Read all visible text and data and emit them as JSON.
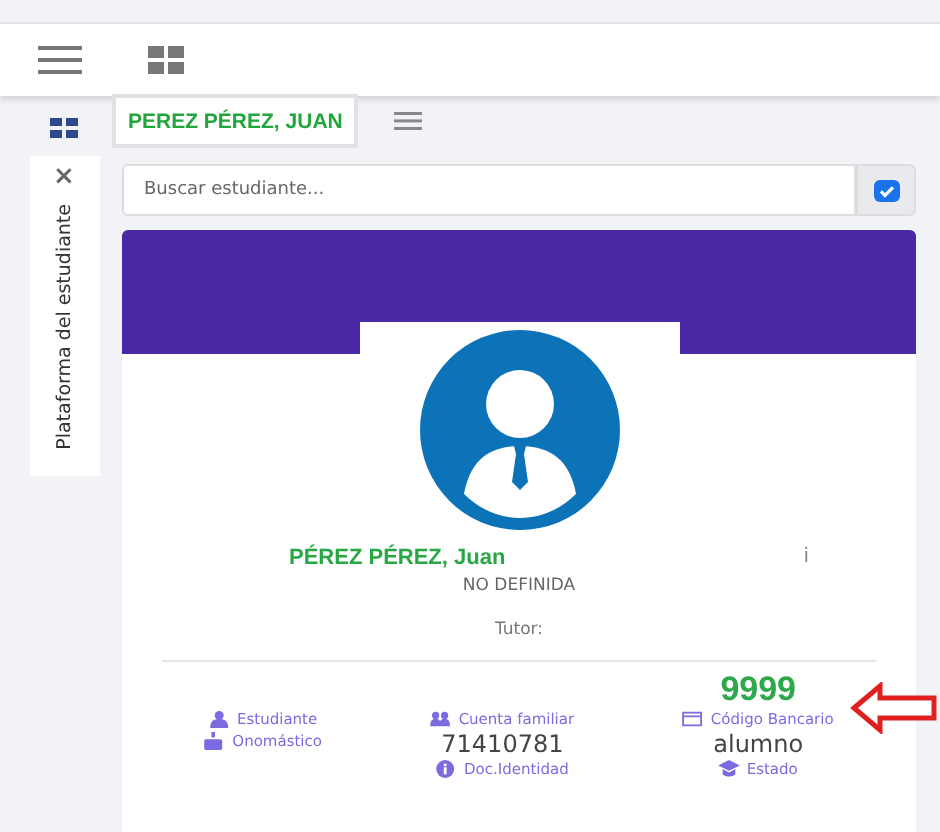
{
  "side_tab": {
    "label": "Plataforma del estudiante",
    "close": "×"
  },
  "student_tab": {
    "label": "PEREZ PÉREZ, JUAN",
    "selected": true
  },
  "search": {
    "placeholder": "Buscar estudiante..."
  },
  "profile": {
    "name": "PÉREZ PÉREZ, Juan",
    "info_mark": "i",
    "status": "NO DEFINIDA",
    "tutor": "Tutor:"
  },
  "details": [
    [
      {
        "kind": "label",
        "text": "Estudiante"
      },
      {
        "kind": "label",
        "text": "Onomástico"
      }
    ],
    [
      {
        "kind": "label",
        "text": "Cuenta familiar"
      },
      {
        "kind": "value",
        "text": "71410781"
      },
      {
        "kind": "label",
        "text": "Doc.Identidad"
      }
    ],
    [
      {
        "kind": "highlight",
        "text": "9999"
      },
      {
        "kind": "label",
        "text": "Código Bancario"
      },
      {
        "kind": "value",
        "text": "alumno"
      },
      {
        "kind": "label",
        "text": "Estado"
      }
    ]
  ]
}
